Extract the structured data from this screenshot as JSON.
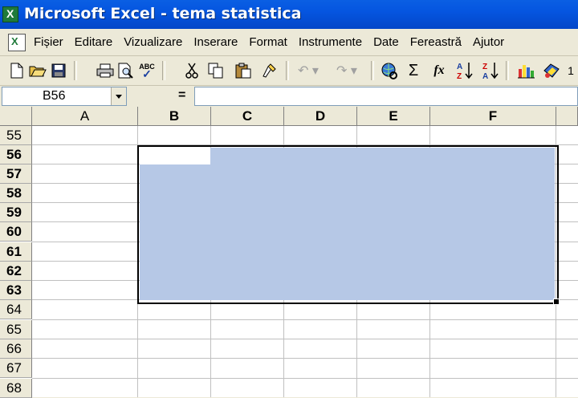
{
  "window": {
    "title": "Microsoft Excel - tema statistica"
  },
  "menu": [
    "Fișier",
    "Editare",
    "Vizualizare",
    "Inserare",
    "Format",
    "Instrumente",
    "Date",
    "Fereastră",
    "Ajutor"
  ],
  "toolbar": {
    "icons": [
      "new-icon",
      "open-icon",
      "save-icon",
      "print-icon",
      "print-preview-icon",
      "spelling-icon",
      "cut-icon",
      "copy-icon",
      "paste-icon",
      "format-painter-icon",
      "undo-icon",
      "redo-icon",
      "hyperlink-icon",
      "autosum-icon",
      "function-icon",
      "sort-ascending-icon",
      "sort-descending-icon",
      "chart-wizard-icon",
      "drawing-icon"
    ],
    "autosum_glyph": "Σ",
    "function_glyph": "fx",
    "sort_asc_glyph": "A↓Z",
    "sort_desc_glyph": "Z↓A",
    "spelling_glyph": "ABC",
    "zoom_fragment": "1"
  },
  "formula_bar": {
    "name_box": "B56",
    "equals": "=",
    "formula": ""
  },
  "sheet": {
    "columns": [
      "A",
      "B",
      "C",
      "D",
      "E",
      "F"
    ],
    "rows": [
      "55",
      "56",
      "57",
      "58",
      "59",
      "60",
      "61",
      "62",
      "63",
      "64",
      "65",
      "66",
      "67",
      "68"
    ],
    "selected_range": "B56:F63",
    "active_cell": "B56",
    "selection_color": "#b6c8e6"
  }
}
